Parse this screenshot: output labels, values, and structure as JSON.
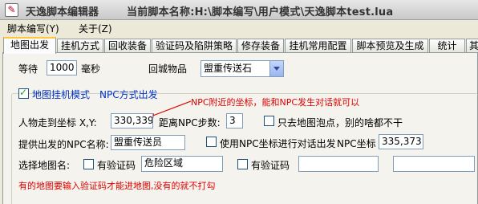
{
  "window": {
    "app_title": "天逸脚本编辑器",
    "script_label": "当前脚本名称:H:\\脚本编写\\用户模式\\天逸脚本test.lua",
    "icon_glyph": "✎"
  },
  "menu": {
    "items": [
      {
        "label": "脚本编写(Y)"
      },
      {
        "label": "关于(Z)"
      }
    ]
  },
  "tabs": [
    {
      "label": "地图出发",
      "active": true
    },
    {
      "label": "挂机方式"
    },
    {
      "label": "回收装备"
    },
    {
      "label": "验证码及陷阱策略"
    },
    {
      "label": "修存装备"
    },
    {
      "label": "挂机常用配置"
    },
    {
      "label": "脚本预览及生成"
    },
    {
      "label": "统计"
    },
    {
      "label": "其"
    }
  ],
  "wait": {
    "label": "等待",
    "value": "1000",
    "unit": "毫秒"
  },
  "return_item": {
    "label": "回城物品",
    "selected": "盟重传送石"
  },
  "map_mode": {
    "checkbox_label": "地图挂机模式",
    "checked": true,
    "npc_mode": "NPC方式出发",
    "annotation": "NPC附近的坐标，能和NPC发生对话就可以"
  },
  "walk_coords": {
    "label": "人物走到坐标 X,Y:",
    "value": "330,339"
  },
  "npc_steps": {
    "label": "距离NPC步数:",
    "value": "3"
  },
  "only_map_point": {
    "label": "只去地图泡点，别的啥都不干",
    "checked": false
  },
  "npc_name": {
    "label": "提供出发的NPC名称:",
    "value": "盟重传送员"
  },
  "use_npc_coords": {
    "label": "使用NPC坐标进行对话出发",
    "checked": false,
    "coord_label": "NPC坐标",
    "coord_value": "335,373"
  },
  "select_map": {
    "label": "选择地图名:",
    "captcha1_label": "有验证码",
    "captcha1_checked": false,
    "map1_value": "危险区域",
    "captcha2_label": "有验证码",
    "captcha2_checked": false,
    "map2_value": "",
    "map3_value": ""
  },
  "footer_note": "有的地图要输入验证码才能进地图,没有的就不打勾",
  "colors": {
    "annotation": "#E00000",
    "npc_mode": "#0033CC",
    "tab_highlight": "#FFC73C"
  }
}
